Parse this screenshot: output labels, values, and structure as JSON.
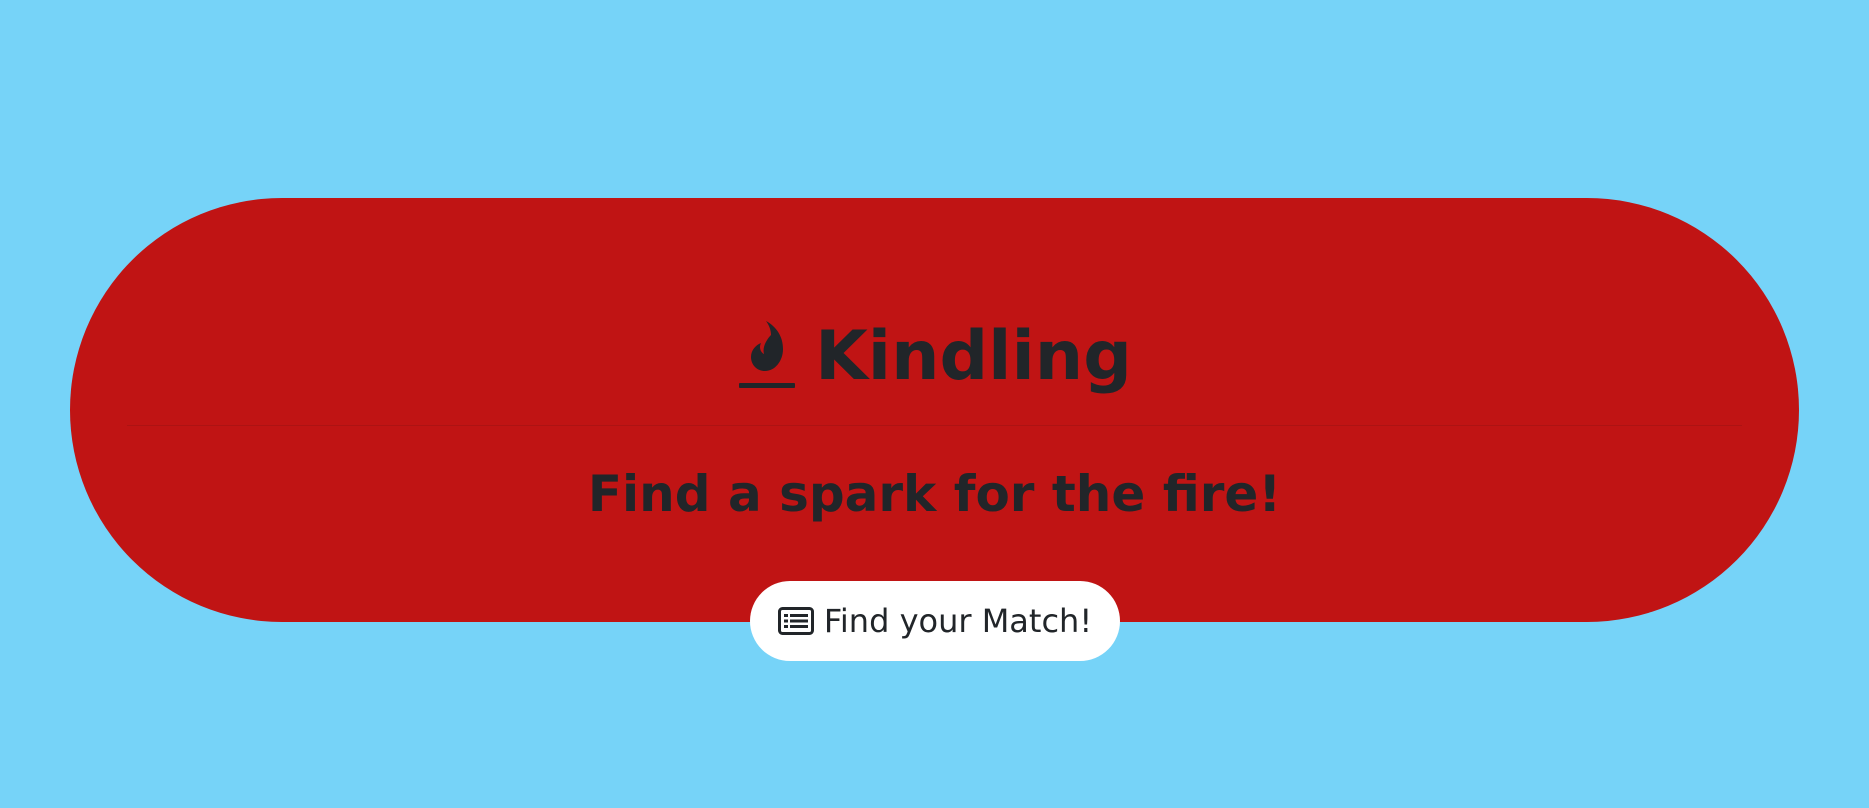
{
  "colors": {
    "page_background": "#76d3f8",
    "hero_background": "#c01414",
    "text": "#212529",
    "button_background": "#ffffff",
    "divider": "#8a1010"
  },
  "hero": {
    "title": "Kindling",
    "title_icon": "fire-icon",
    "subtitle": "Find a spark for the fire!"
  },
  "cta": {
    "label": "Find your Match!",
    "icon": "card-list-icon"
  }
}
